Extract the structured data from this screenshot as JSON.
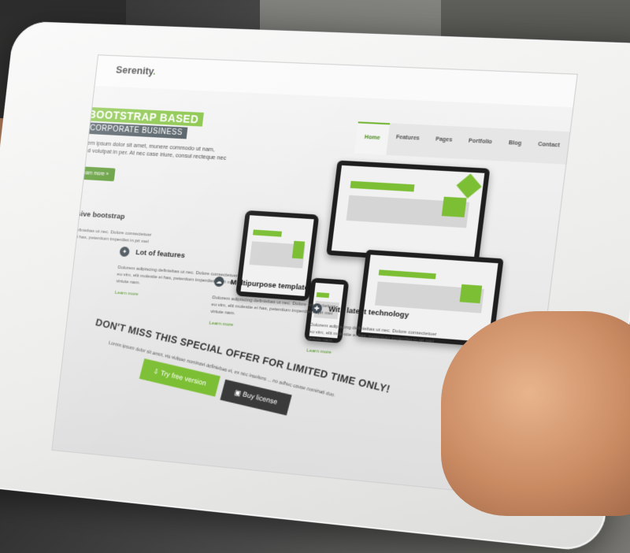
{
  "site": {
    "logo": "Serenity",
    "nav": [
      "Home",
      "Features",
      "Pages",
      "Portfolio",
      "Blog",
      "Contact"
    ]
  },
  "hero": {
    "tag1": "BOOTSTRAP BASED",
    "tag2": "CORPORATE BUSINESS",
    "text": "Lorem ipsum dolor sit amet, munere commodo ut nam, quod volutpat in per. At nec case iriure, consul recteque nec et.",
    "button": "Learn more »"
  },
  "features": [
    {
      "title": "Responsive bootstrap",
      "icon": "leaf-icon",
      "desc": "Dolorem adipiscing definiebas ut nec. Dolore consectetuer eu vim, elit molestie ei has, petentium imperdiet in pri mel virtute nam.",
      "more": "more"
    },
    {
      "title": "Lot of features",
      "icon": "pin-icon",
      "desc": "Dolorem adipiscing definiebas ut nec. Dolore consectetuer eu vim, elit molestie ei has, petentium imperdiet in pri mel virtute nam.",
      "more": "Learn more"
    },
    {
      "title": "Multipurpose template",
      "icon": "cloud-icon",
      "desc": "Dolorem adipiscing definiebas ut nec. Dolore consectetuer eu vim, elit molestie ei has, petentium imperdiet in pri mel virtute nam.",
      "more": "Learn more"
    },
    {
      "title": "With latest technology",
      "icon": "wrench-icon",
      "desc": "Dolorem adipiscing definiebas ut nec. Dolore consectetuer eu vim, elit molestie ei has, petentium imperdiet in pri mel virtute nam.",
      "more": "Learn more"
    }
  ],
  "offer": {
    "title": "DON'T MISS THIS SPECIAL OFFER FOR LIMITED TIME ONLY!",
    "text": "Lorem ipsum dolor sit amet, vis vidisse nominavi definiebas ei, ex nec insolens ... no adhuc cause nominati duo.",
    "try_button": "Try free version",
    "buy_button": "Buy license"
  },
  "colors": {
    "accent": "#7cbf34",
    "dark": "#3d4a52"
  }
}
